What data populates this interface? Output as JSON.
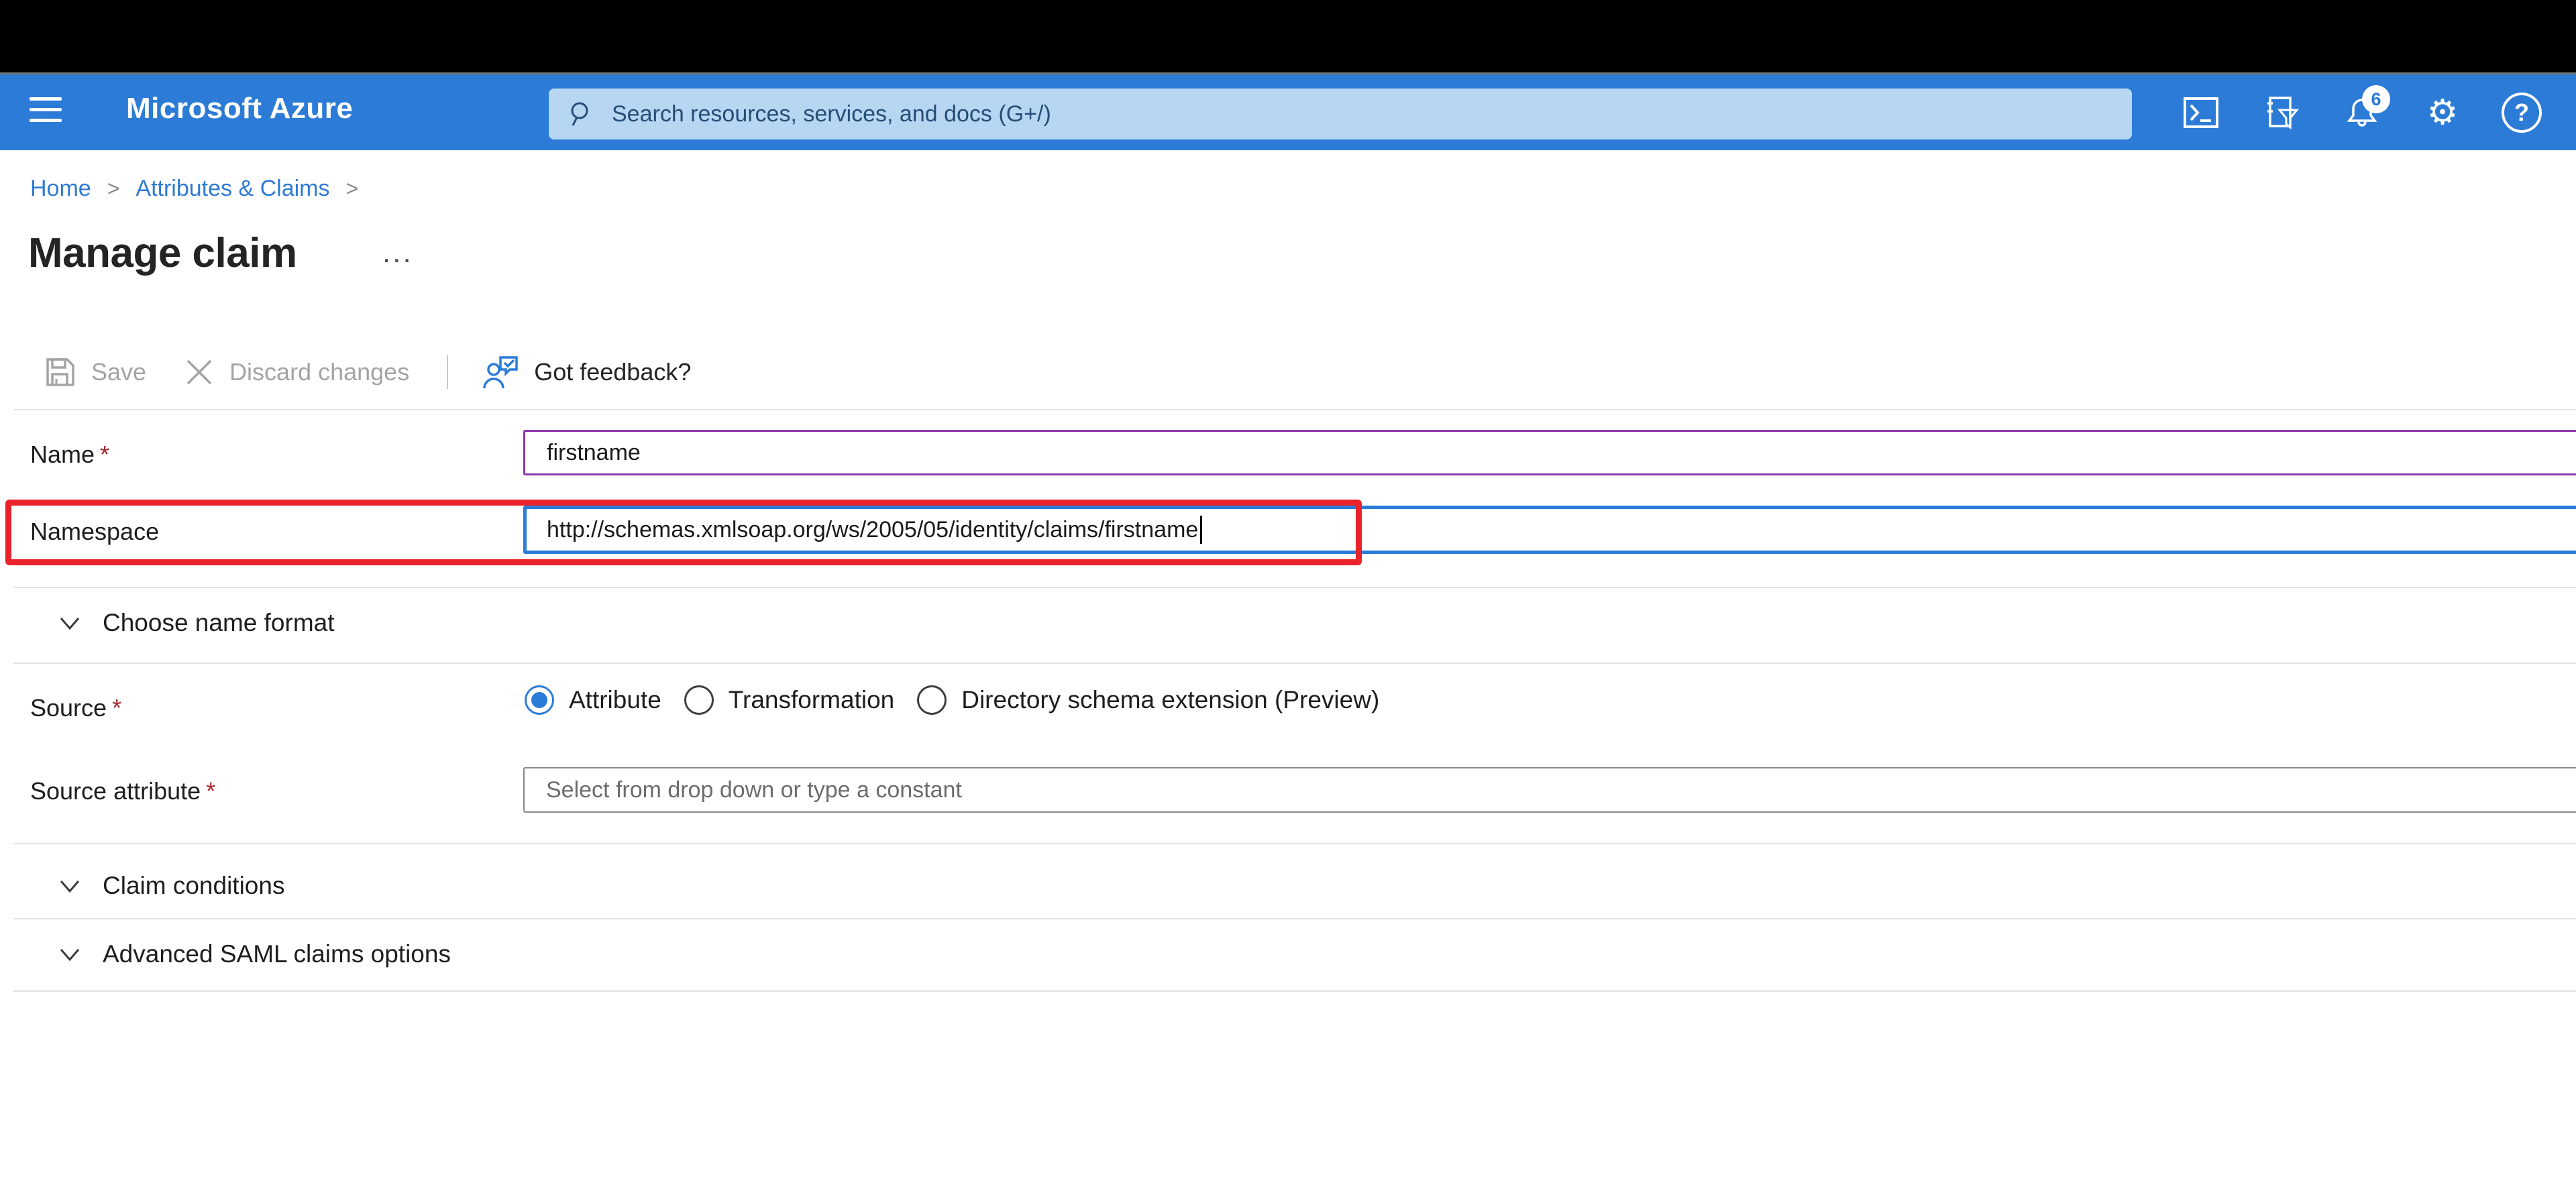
{
  "topbar": {
    "brand": "Microsoft Azure",
    "search_placeholder": "Search resources, services, and docs (G+/)",
    "notification_count": "6",
    "gear_glyph": "⚙",
    "help_glyph": "?"
  },
  "breadcrumb": {
    "items": [
      "Home",
      "Attributes & Claims"
    ],
    "separator": ">"
  },
  "page": {
    "title": "Manage claim",
    "more_label": "..."
  },
  "toolbar": {
    "save_label": "Save",
    "discard_label": "Discard changes",
    "feedback_label": "Got feedback?"
  },
  "form": {
    "required_marker": "*",
    "name": {
      "label": "Name",
      "value": "firstname"
    },
    "namespace": {
      "label": "Namespace",
      "value": "http://schemas.xmlsoap.org/ws/2005/05/identity/claims/firstname"
    },
    "choose_name_format_label": "Choose name format",
    "source": {
      "label": "Source",
      "options": [
        "Attribute",
        "Transformation",
        "Directory schema extension (Preview)"
      ],
      "selected": "Attribute"
    },
    "source_attribute": {
      "label": "Source attribute",
      "placeholder": "Select from drop down or type a constant"
    },
    "claim_conditions_label": "Claim conditions",
    "advanced_label": "Advanced SAML claims options"
  },
  "colors": {
    "header_blue": "#2b7bd7",
    "link_blue": "#2e7ad4",
    "focus_blue": "#2b7cd9",
    "name_border_purple": "#8b36ad",
    "annotation_red": "#e9222c",
    "required_red": "#a4262c"
  }
}
